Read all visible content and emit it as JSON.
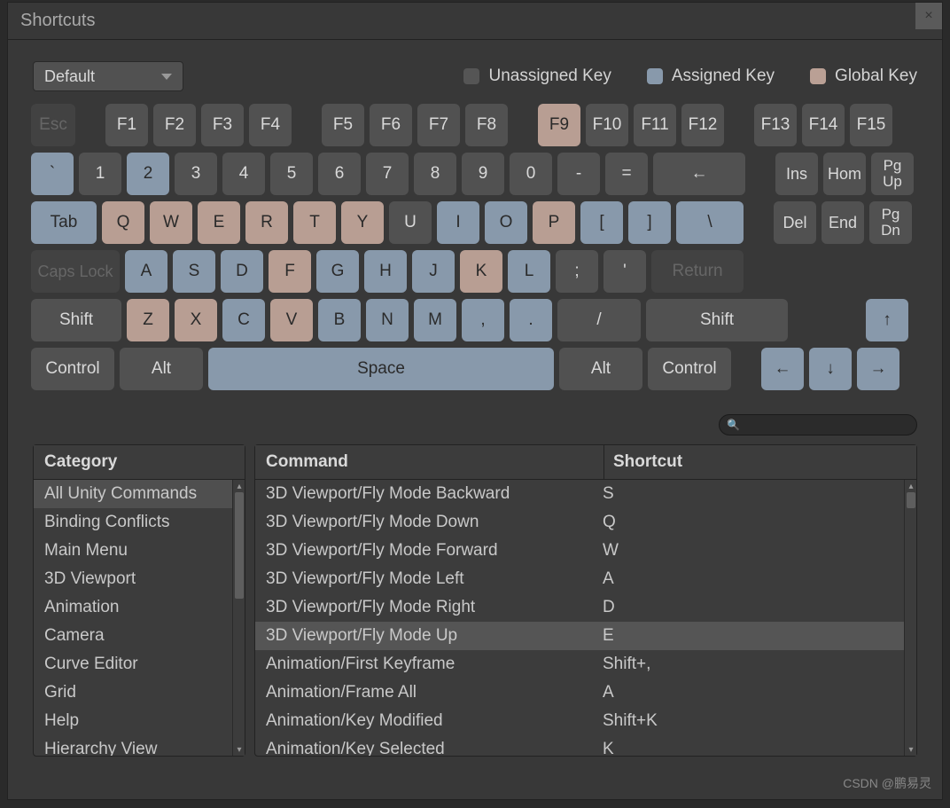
{
  "title": "Shortcuts",
  "close_label": "×",
  "profile": {
    "selected": "Default"
  },
  "legend": {
    "unassigned": "Unassigned Key",
    "assigned": "Assigned Key",
    "global": "Global Key"
  },
  "keys": {
    "esc": "Esc",
    "f1": "F1",
    "f2": "F2",
    "f3": "F3",
    "f4": "F4",
    "f5": "F5",
    "f6": "F6",
    "f7": "F7",
    "f8": "F8",
    "f9": "F9",
    "f10": "F10",
    "f11": "F11",
    "f12": "F12",
    "f13": "F13",
    "f14": "F14",
    "f15": "F15",
    "backtick": "`",
    "1": "1",
    "2": "2",
    "3": "3",
    "4": "4",
    "5": "5",
    "6": "6",
    "7": "7",
    "8": "8",
    "9": "9",
    "0": "0",
    "minus": "-",
    "equals": "=",
    "backspace": "←",
    "ins": "Ins",
    "home": "Hom",
    "pgup": "Pg\nUp",
    "tab": "Tab",
    "q": "Q",
    "w": "W",
    "e": "E",
    "r": "R",
    "t": "T",
    "y": "Y",
    "u": "U",
    "i": "I",
    "o": "O",
    "p": "P",
    "lbracket": "[",
    "rbracket": "]",
    "backslash": "\\",
    "del": "Del",
    "end": "End",
    "pgdn": "Pg\nDn",
    "caps": "Caps Lock",
    "a": "A",
    "s": "S",
    "d": "D",
    "f": "F",
    "g": "G",
    "h": "H",
    "j": "J",
    "k": "K",
    "l": "L",
    "semicolon": ";",
    "quote": "'",
    "return": "Return",
    "shift": "Shift",
    "z": "Z",
    "x": "X",
    "c": "C",
    "v": "V",
    "b": "B",
    "n": "N",
    "m": "M",
    "comma": ",",
    "period": ".",
    "slash": "/",
    "control": "Control",
    "alt": "Alt",
    "space": "Space",
    "up": "↑",
    "down": "↓",
    "left": "←",
    "right": "→"
  },
  "search_placeholder": "",
  "category_header": "Category",
  "command_header": "Command",
  "shortcut_header": "Shortcut",
  "categories": [
    "All Unity Commands",
    "Binding Conflicts",
    "Main Menu",
    "3D Viewport",
    "Animation",
    "Camera",
    "Curve Editor",
    "Grid",
    "Help",
    "Hierarchy View"
  ],
  "selected_category_index": 0,
  "commands": [
    {
      "cmd": "3D Viewport/Fly Mode Backward",
      "sc": "S"
    },
    {
      "cmd": "3D Viewport/Fly Mode Down",
      "sc": "Q"
    },
    {
      "cmd": "3D Viewport/Fly Mode Forward",
      "sc": "W"
    },
    {
      "cmd": "3D Viewport/Fly Mode Left",
      "sc": "A"
    },
    {
      "cmd": "3D Viewport/Fly Mode Right",
      "sc": "D"
    },
    {
      "cmd": "3D Viewport/Fly Mode Up",
      "sc": "E"
    },
    {
      "cmd": "Animation/First Keyframe",
      "sc": "Shift+,"
    },
    {
      "cmd": "Animation/Frame All",
      "sc": "A"
    },
    {
      "cmd": "Animation/Key Modified",
      "sc": "Shift+K"
    },
    {
      "cmd": "Animation/Key Selected",
      "sc": "K"
    }
  ],
  "hover_command_index": 5,
  "watermark": "CSDN @鹏易灵"
}
